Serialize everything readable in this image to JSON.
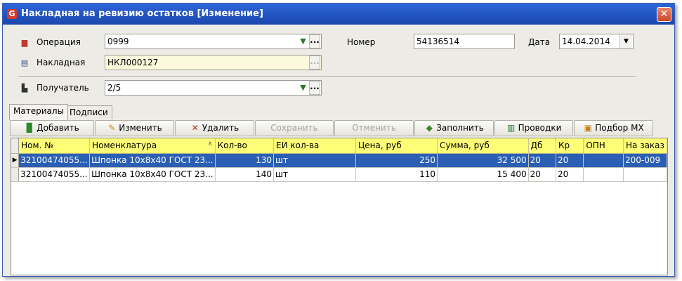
{
  "window": {
    "title": "Накладная на ревизию остатков [Изменение]",
    "app_icon_glyph": "G",
    "close_glyph": "✕"
  },
  "form": {
    "operation_label": "Операция",
    "operation_value": "0999",
    "invoice_label": "Накладная",
    "invoice_value": "НКЛ000127",
    "recipient_label": "Получатель",
    "recipient_value": "2/5",
    "number_label": "Номер",
    "number_value": "54136514",
    "date_label": "Дата",
    "date_value": "14.04.2014",
    "pick_icon": "pin-icon",
    "ellipsis_label": "..."
  },
  "tabs": [
    {
      "label": "Материалы",
      "active": true
    },
    {
      "label": "Подписи",
      "active": false
    }
  ],
  "toolbar": {
    "add": "Добавить",
    "edit": "Изменить",
    "delete": "Удалить",
    "save": "Сохранить",
    "cancel": "Отменить",
    "fill": "Заполнить",
    "postings": "Проводки",
    "select_mx": "Подбор МХ"
  },
  "grid": {
    "columns": [
      "Ном. №",
      "Номенклатура",
      "Кол-во",
      "ЕИ кол-ва",
      "Цена, руб",
      "Сумма, руб",
      "Дб",
      "Кр",
      "ОПН",
      "На заказ"
    ],
    "rows": [
      [
        "32100474055...",
        "Шпонка 10x8x40 ГОСТ 23...",
        "130",
        "шт",
        "250",
        "32 500",
        "20",
        "20",
        "",
        "200-009"
      ],
      [
        "32100474055...",
        "Шпонка 10x8x40 ГОСТ 23...",
        "140",
        "шт",
        "110",
        "15 400",
        "20",
        "20",
        "",
        ""
      ]
    ],
    "selected_row": 0
  },
  "colors": {
    "title_bar": "#2356c5",
    "header_bg": "#ffff77",
    "selection": "#2b5fb4",
    "readonly_field": "#fcf9dc"
  }
}
